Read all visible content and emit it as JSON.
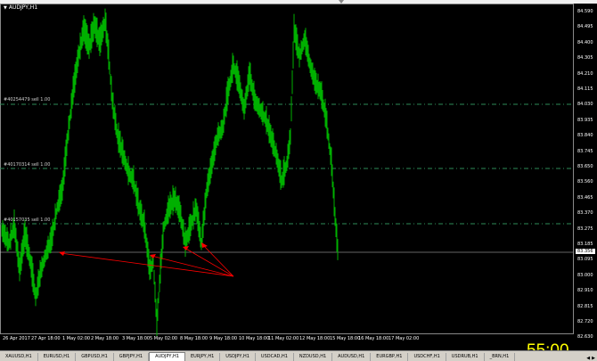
{
  "window": {
    "title": "AUDJPY,H1"
  },
  "price_axis": {
    "labels": [
      "84.590",
      "84.495",
      "84.400",
      "84.305",
      "84.210",
      "84.115",
      "84.030",
      "83.935",
      "83.840",
      "83.745",
      "83.650",
      "83.560",
      "83.465",
      "83.370",
      "83.275",
      "83.185",
      "83.095",
      "83.000",
      "82.910",
      "82.815",
      "82.720",
      "82.630"
    ],
    "current_price": "83.356"
  },
  "time_axis": {
    "labels": [
      "26 Apr 2017",
      "27 Apr 18:00",
      "1 May 02:00",
      "2 May 18:00",
      "3 May 18:00",
      "5 May 02:00",
      "8 May 18:00",
      "9 May 18:00",
      "10 May 18:00",
      "11 May 02:00",
      "12 May 18:00",
      "15 May 18:00",
      "16 May 18:00",
      "17 May 02:00"
    ]
  },
  "levels": [
    {
      "label": "#40254479 sell 1.00"
    },
    {
      "label": "#40170314 sell 1.00"
    },
    {
      "label": "#40157035 sell 1.00"
    }
  ],
  "timer": "55:00",
  "tabs": [
    "XAUUSD,H1",
    "EURUSD,H1",
    "GBPUSD,H1",
    "GBPJPY,H1",
    "AUDJPY,H1",
    "EURJPY,H1",
    "USDJPY,H1",
    "USDCAD,H1",
    "NZDUSD,H1",
    "AUDUSD,H1",
    "EURGBP,H1",
    "USDCHF,H1",
    "USDRUB,H1",
    "_BRN,H1"
  ],
  "active_tab": "AUDJPY,H1",
  "colors": {
    "candles": "#00b000",
    "grid_levels": "#2e8b57",
    "arrows": "#ff0000",
    "timer": "#ffff00",
    "background": "#000000"
  }
}
